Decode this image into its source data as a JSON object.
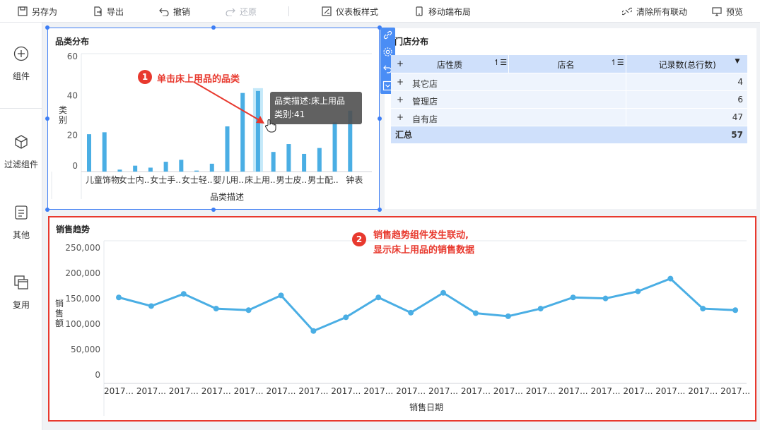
{
  "toolbar": {
    "save_as": "另存为",
    "export": "导出",
    "undo": "撤销",
    "redo": "还原",
    "dashboard_style": "仪表板样式",
    "mobile_layout": "移动端布局",
    "clear_links": "清除所有联动",
    "preview": "预览"
  },
  "sidebar": {
    "items": [
      {
        "label": "组件",
        "icon": "plus-circle-icon"
      },
      {
        "label": "过滤组件",
        "icon": "cube-icon"
      },
      {
        "label": "其他",
        "icon": "document-icon"
      },
      {
        "label": "复用",
        "icon": "copy-icon"
      }
    ]
  },
  "category_panel": {
    "title": "品类分布",
    "tooltip_line1": "品类描述:床上用品",
    "tooltip_line2": "类别:41"
  },
  "store_panel": {
    "title": "门店分布",
    "columns": [
      "店性质",
      "店名",
      "记录数(总行数)"
    ],
    "rows": [
      {
        "type": "其它店",
        "count": "4"
      },
      {
        "type": "管理店",
        "count": "6"
      },
      {
        "type": "自有店",
        "count": "47"
      }
    ],
    "total_label": "汇总",
    "total_value": "57",
    "expand_symbol": "+"
  },
  "trend_panel": {
    "title": "销售趋势"
  },
  "annotations": {
    "step1_num": "1",
    "step1_text": "单击床上用品的品类",
    "step2_num": "2",
    "step2_line1": "销售趋势组件发生联动,",
    "step2_line2": "显示床上用品的销售数据"
  },
  "colors": {
    "accent": "#3d7ef5",
    "bar": "#4aaee4",
    "line": "#4aaee4",
    "highlight_box": "#e8392e",
    "table_header": "#cfe0fb"
  },
  "chart_data": [
    {
      "type": "bar",
      "ylabel": "类别",
      "xlabel": "品类描述",
      "ylim": [
        0,
        60
      ],
      "yticks": [
        0,
        20,
        40,
        60
      ],
      "xticklabels": [
        "儿童饰物",
        "女士内..",
        "女士手..",
        "女士轻..",
        "婴儿用..",
        "床上用..",
        "男士皮..",
        "男士配..",
        "钟表"
      ],
      "values": [
        19,
        20,
        1,
        3,
        2,
        5,
        6,
        0.5,
        4,
        23,
        40,
        41,
        10,
        14,
        9,
        12,
        25,
        31
      ],
      "highlight_index": 11
    },
    {
      "type": "line",
      "ylabel": "销售额",
      "xlabel": "销售日期",
      "ylim": [
        0,
        250000
      ],
      "yticks": [
        "0",
        "50,000",
        "100,000",
        "150,000",
        "200,000",
        "250,000"
      ],
      "xticklabel": "2017...",
      "values": [
        158000,
        141000,
        165000,
        136000,
        133000,
        162000,
        92000,
        119000,
        158000,
        128000,
        167000,
        127000,
        121000,
        136000,
        158000,
        156000,
        170000,
        195000,
        136000,
        133000
      ]
    }
  ]
}
